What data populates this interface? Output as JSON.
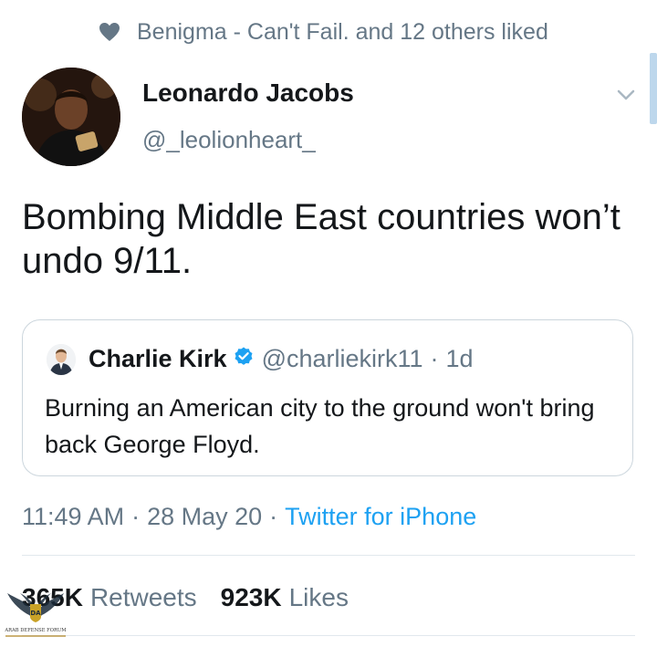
{
  "social_context": {
    "icon": "heart-icon",
    "text": "Benigma - Can't Fail. and 12 others liked"
  },
  "tweet": {
    "author": {
      "name": "Leonardo Jacobs",
      "handle": "@_leolionheart_"
    },
    "text": "Bombing Middle East countries won’t undo 9/11.",
    "quoted": {
      "name": "Charlie Kirk",
      "handle": "@charliekirk11",
      "separator": "·",
      "time": "1d",
      "verified": true,
      "text": "Burning an American city to the ground won't bring back George Floyd."
    },
    "meta": {
      "time": "11:49 AM",
      "separator": "·",
      "date": "28 May 20",
      "separator2": "·",
      "source": "Twitter for iPhone"
    },
    "stats": {
      "retweets_count": "365K",
      "retweets_label": "Retweets",
      "likes_count": "923K",
      "likes_label": "Likes"
    }
  },
  "watermark": {
    "badge": "DA",
    "line1": "ARAB DEFENSE FORUM"
  },
  "colors": {
    "link": "#1da1f2",
    "muted": "#657786",
    "verified": "#1da1f2",
    "border": "#ccd6dd"
  }
}
